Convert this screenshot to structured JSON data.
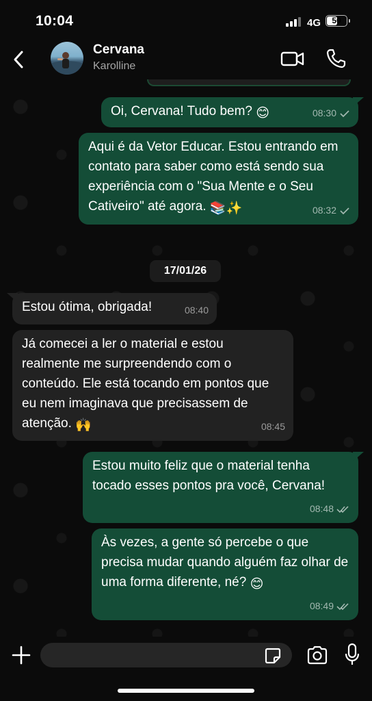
{
  "status": {
    "time": "10:04",
    "network": "4G",
    "battery": "50"
  },
  "header": {
    "name": "Cervana",
    "subtitle": "Karolline"
  },
  "chat": {
    "previous_time": "08:30",
    "date_divider": "17/01/26",
    "messages": [
      {
        "dir": "out",
        "text": "Oi, Cervana! Tudo bem?",
        "emoji": "😊",
        "time": "08:30",
        "status": "sent"
      },
      {
        "dir": "out",
        "text": "Aqui é da Vetor Educar. Estou entrando em contato para saber como está sendo sua experiência com o \"Sua Mente e o Seu Cativeiro\" até agora.",
        "emoji": "📚✨",
        "time": "08:32",
        "status": "sent"
      },
      {
        "dir": "in",
        "text": "Estou ótima, obrigada!",
        "emoji": "",
        "time": "08:40"
      },
      {
        "dir": "in",
        "text": "Já comecei a ler o material e estou realmente me surpreendendo com o conteúdo. Ele está tocando em pontos que eu nem imaginava que precisassem de atenção.",
        "emoji": "🙌",
        "time": "08:45"
      },
      {
        "dir": "out",
        "text": "Estou muito feliz que o material tenha tocado esses pontos pra você, Cervana!",
        "emoji": "",
        "time": "08:48",
        "status": "delivered"
      },
      {
        "dir": "out",
        "text": "Às vezes, a gente só percebe o que precisa mudar quando alguém faz olhar de uma forma diferente, né?",
        "emoji": "😊",
        "time": "08:49",
        "status": "delivered"
      }
    ]
  },
  "input": {
    "placeholder": ""
  },
  "colors": {
    "outgoing": "#144d37",
    "incoming": "#222222",
    "background": "#0b0b0b"
  }
}
